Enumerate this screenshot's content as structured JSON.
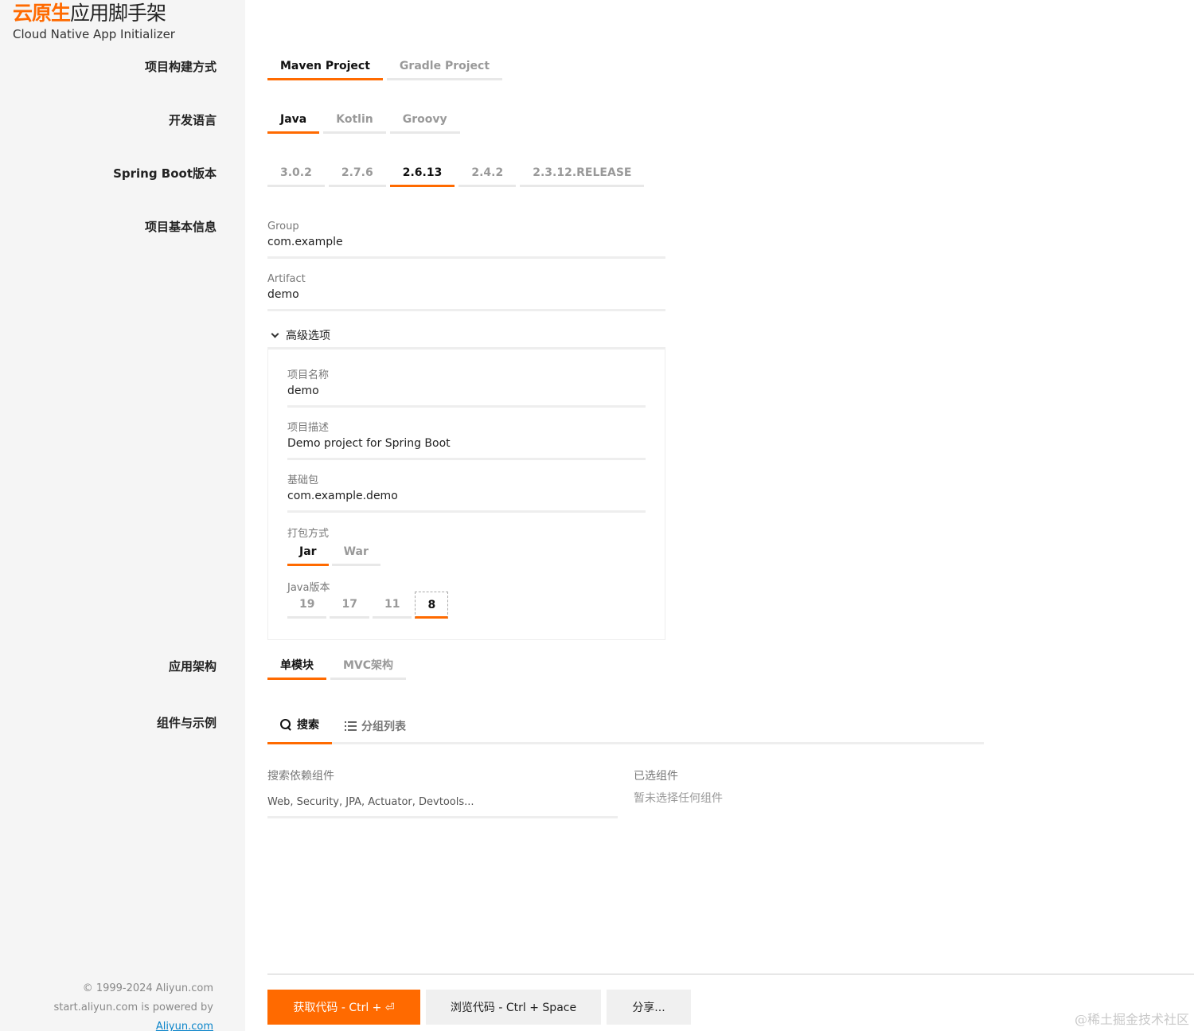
{
  "brand": {
    "title_accent": "云原生",
    "title_rest": "应用脚手架",
    "subtitle": "Cloud Native App Initializer"
  },
  "sections": {
    "build": "项目构建方式",
    "language": "开发语言",
    "boot": "Spring Boot版本",
    "basic": "项目基本信息",
    "arch": "应用架构",
    "deps": "组件与示例"
  },
  "build_tabs": [
    "Maven Project",
    "Gradle Project"
  ],
  "language_tabs": [
    "Java",
    "Kotlin",
    "Groovy"
  ],
  "boot_tabs": [
    "3.0.2",
    "2.7.6",
    "2.6.13",
    "2.4.2",
    "2.3.12.RELEASE"
  ],
  "basic": {
    "group_label": "Group",
    "group_value": "com.example",
    "artifact_label": "Artifact",
    "artifact_value": "demo"
  },
  "advanced": {
    "toggle_label": "高级选项",
    "name_label": "项目名称",
    "name_value": "demo",
    "desc_label": "项目描述",
    "desc_value": "Demo project for Spring Boot",
    "package_label": "基础包",
    "package_value": "com.example.demo",
    "packaging_label": "打包方式",
    "packaging_tabs": [
      "Jar",
      "War"
    ],
    "java_label": "Java版本",
    "java_tabs": [
      "19",
      "17",
      "11",
      "8"
    ]
  },
  "arch_tabs": [
    "单模块",
    "MVC架构"
  ],
  "deps": {
    "search_tab": "搜索",
    "group_tab": "分组列表",
    "search_label": "搜索依赖组件",
    "search_placeholder": "Web, Security, JPA, Actuator, Devtools...",
    "selected_label": "已选组件",
    "selected_empty": "暂未选择任何组件"
  },
  "buttons": {
    "get": "获取代码 - Ctrl + ⏎",
    "browse": "浏览代码 - Ctrl + Space",
    "share": "分享..."
  },
  "footer": {
    "copyright": "© 1999-2024 Aliyun.com",
    "powered": "start.aliyun.com is powered by",
    "link": "Aliyun.com"
  },
  "watermark": "@稀土掘金技术社区",
  "colors": {
    "accent": "#ff6a00",
    "sidebar_bg": "#f5f5f5"
  }
}
